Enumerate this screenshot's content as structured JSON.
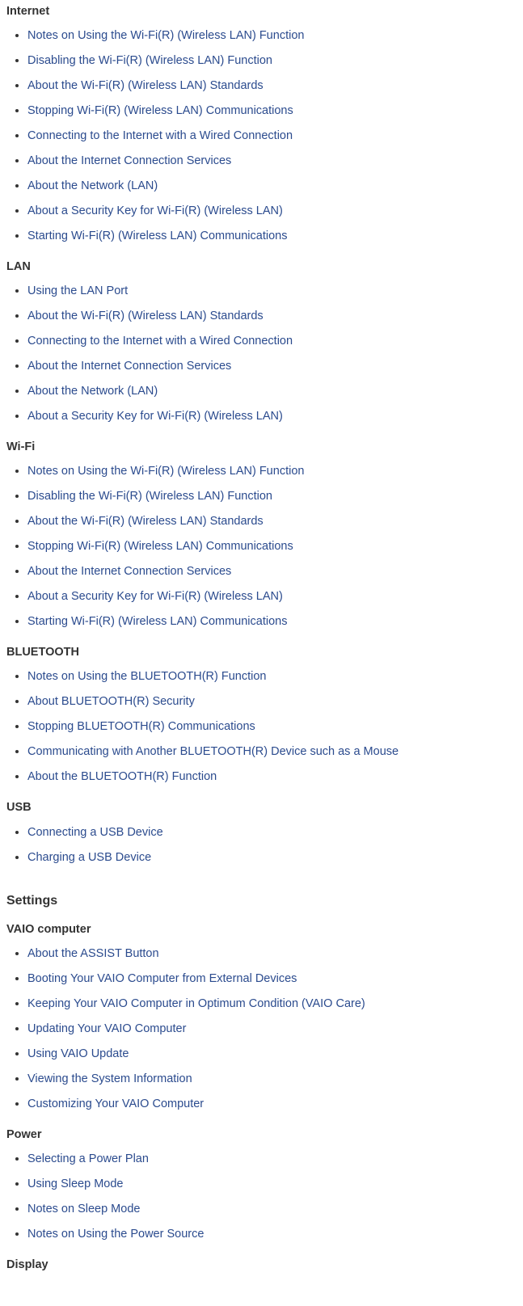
{
  "sections": [
    {
      "groups": [
        {
          "heading": "Internet",
          "first": true,
          "items": [
            "Notes on Using the Wi-Fi(R) (Wireless LAN) Function",
            "Disabling the Wi-Fi(R) (Wireless LAN) Function",
            "About the Wi-Fi(R) (Wireless LAN) Standards",
            "Stopping Wi-Fi(R) (Wireless LAN) Communications",
            "Connecting to the Internet with a Wired Connection",
            "About the Internet Connection Services",
            "About the Network (LAN)",
            "About a Security Key for Wi-Fi(R) (Wireless LAN)",
            "Starting Wi-Fi(R) (Wireless LAN) Communications"
          ]
        },
        {
          "heading": "LAN",
          "items": [
            "Using the LAN Port",
            "About the Wi-Fi(R) (Wireless LAN) Standards",
            "Connecting to the Internet with a Wired Connection",
            "About the Internet Connection Services",
            "About the Network (LAN)",
            "About a Security Key for Wi-Fi(R) (Wireless LAN)"
          ]
        },
        {
          "heading": "Wi-Fi",
          "items": [
            "Notes on Using the Wi-Fi(R) (Wireless LAN) Function",
            "Disabling the Wi-Fi(R) (Wireless LAN) Function",
            "About the Wi-Fi(R) (Wireless LAN) Standards",
            "Stopping Wi-Fi(R) (Wireless LAN) Communications",
            "About the Internet Connection Services",
            "About a Security Key for Wi-Fi(R) (Wireless LAN)",
            "Starting Wi-Fi(R) (Wireless LAN) Communications"
          ]
        },
        {
          "heading": "BLUETOOTH",
          "items": [
            "Notes on Using the BLUETOOTH(R) Function",
            "About BLUETOOTH(R) Security",
            "Stopping BLUETOOTH(R) Communications",
            "Communicating with Another BLUETOOTH(R) Device such as a Mouse",
            "About the BLUETOOTH(R) Function"
          ]
        },
        {
          "heading": "USB",
          "items": [
            "Connecting a USB Device",
            "Charging a USB Device"
          ]
        }
      ]
    },
    {
      "title": "Settings",
      "groups": [
        {
          "heading": "VAIO computer",
          "items": [
            "About the ASSIST Button",
            "Booting Your VAIO Computer from External Devices",
            "Keeping Your VAIO Computer in Optimum Condition (VAIO Care)",
            "Updating Your VAIO Computer",
            "Using VAIO Update",
            "Viewing the System Information",
            "Customizing Your VAIO Computer"
          ]
        },
        {
          "heading": "Power",
          "items": [
            "Selecting a Power Plan",
            "Using Sleep Mode",
            "Notes on Sleep Mode",
            "Notes on Using the Power Source"
          ]
        },
        {
          "heading": "Display",
          "items": []
        }
      ]
    }
  ]
}
